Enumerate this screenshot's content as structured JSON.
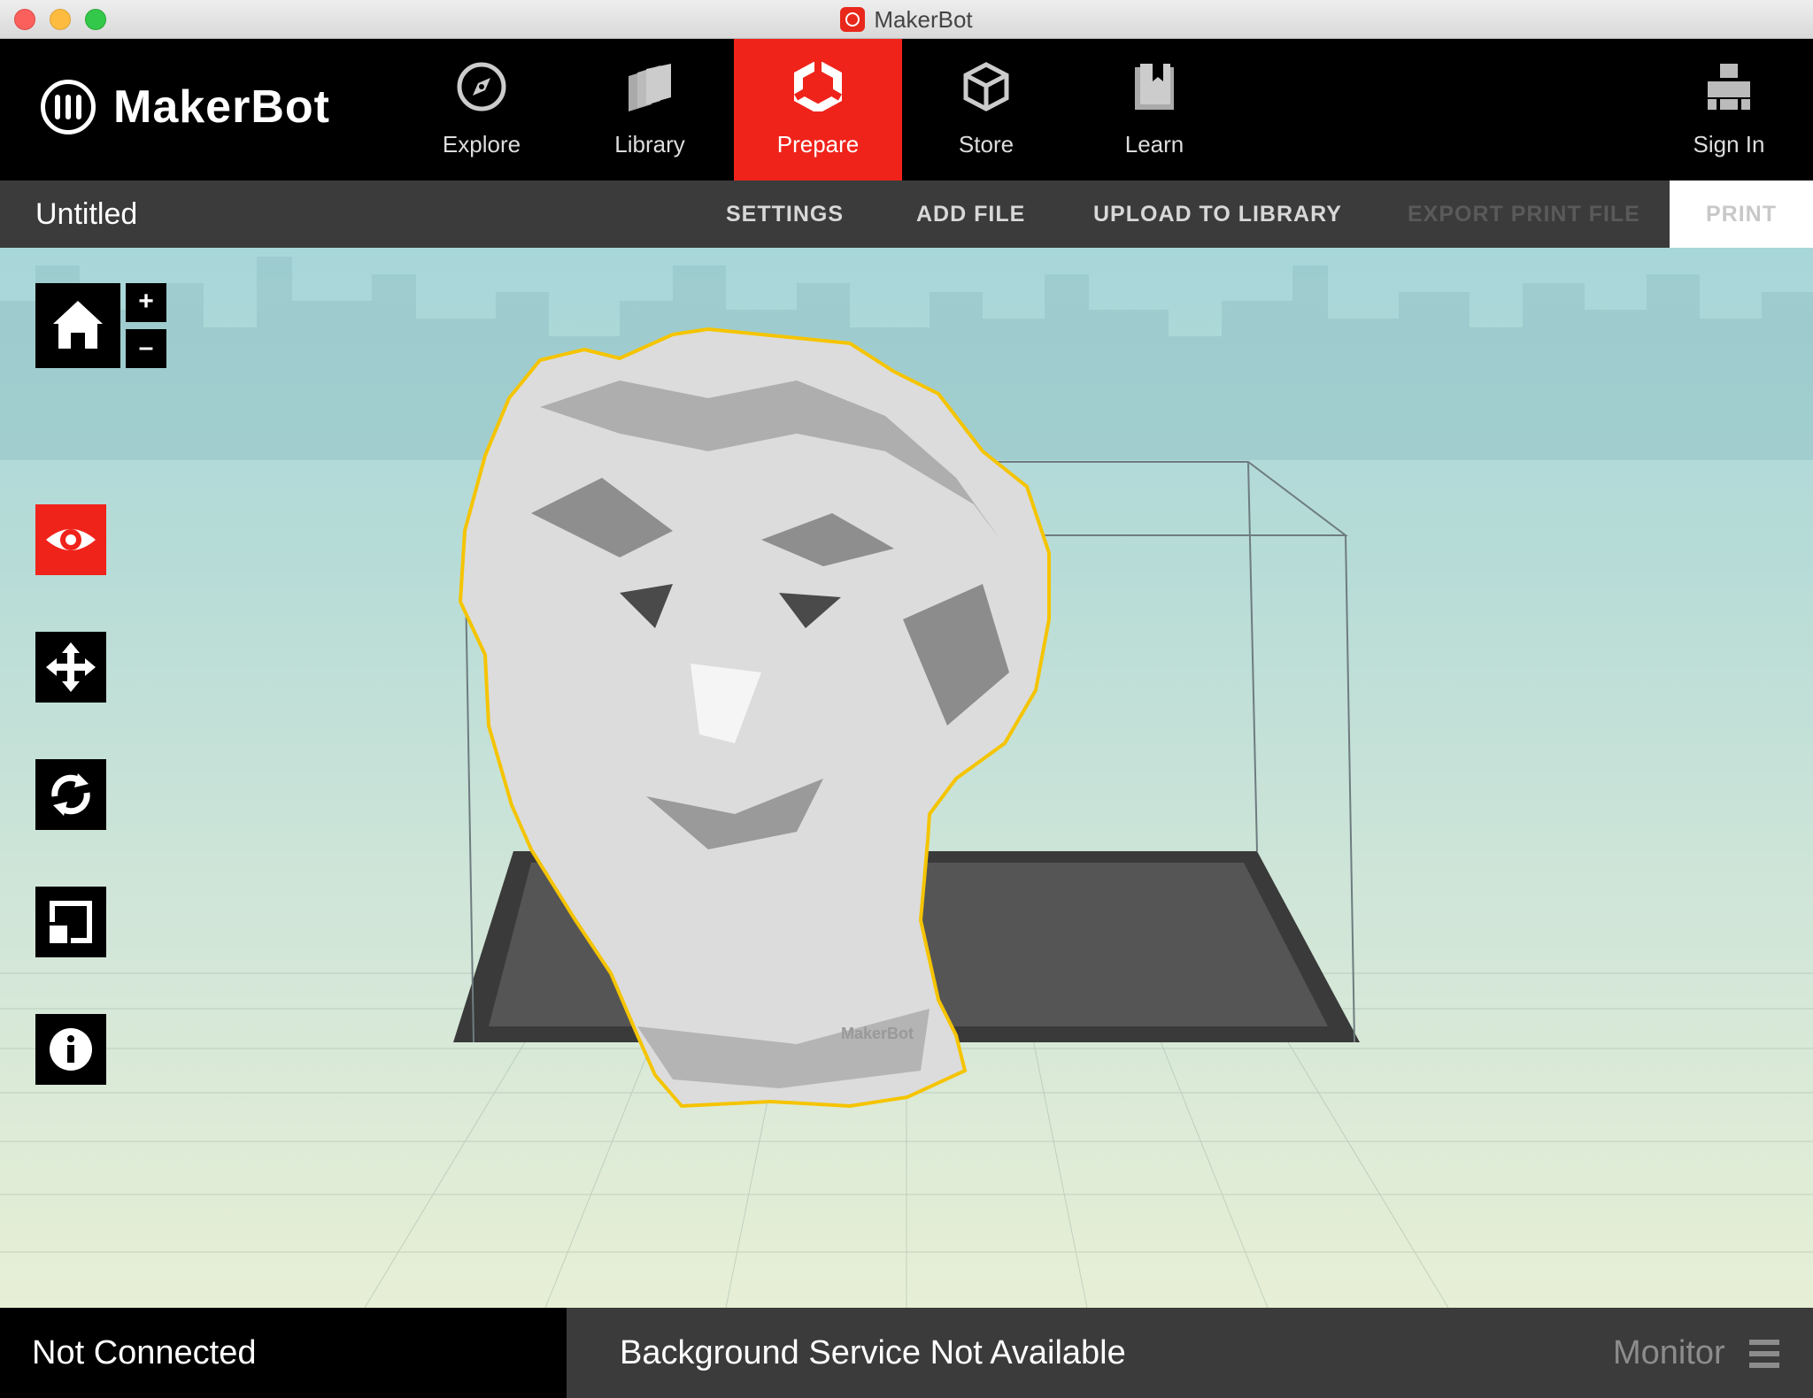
{
  "window": {
    "title": "MakerBot"
  },
  "brand": {
    "name": "MakerBot"
  },
  "nav": {
    "items": [
      {
        "label": "Explore",
        "icon": "compass-icon"
      },
      {
        "label": "Library",
        "icon": "library-stack-icon"
      },
      {
        "label": "Prepare",
        "icon": "prepare-hexagon-icon",
        "active": true
      },
      {
        "label": "Store",
        "icon": "cube-icon"
      },
      {
        "label": "Learn",
        "icon": "book-icon"
      }
    ],
    "sign_in": {
      "label": "Sign In",
      "icon": "user-icon"
    }
  },
  "toolbar": {
    "document_title": "Untitled",
    "settings": "SETTINGS",
    "add_file": "ADD FILE",
    "upload": "UPLOAD TO LIBRARY",
    "export": "EXPORT PRINT FILE",
    "print": "PRINT"
  },
  "viewport": {
    "zoom_in": "+",
    "zoom_out": "–",
    "plate_label": "MakerBot",
    "tools": [
      "home-icon",
      "eye-icon",
      "move-icon",
      "rotate-icon",
      "scale-icon",
      "info-icon"
    ],
    "colors": {
      "accent": "#f0231b",
      "selection_outline": "#f5c400"
    }
  },
  "status": {
    "connection": "Not Connected",
    "service": "Background Service Not Available",
    "monitor": "Monitor"
  }
}
